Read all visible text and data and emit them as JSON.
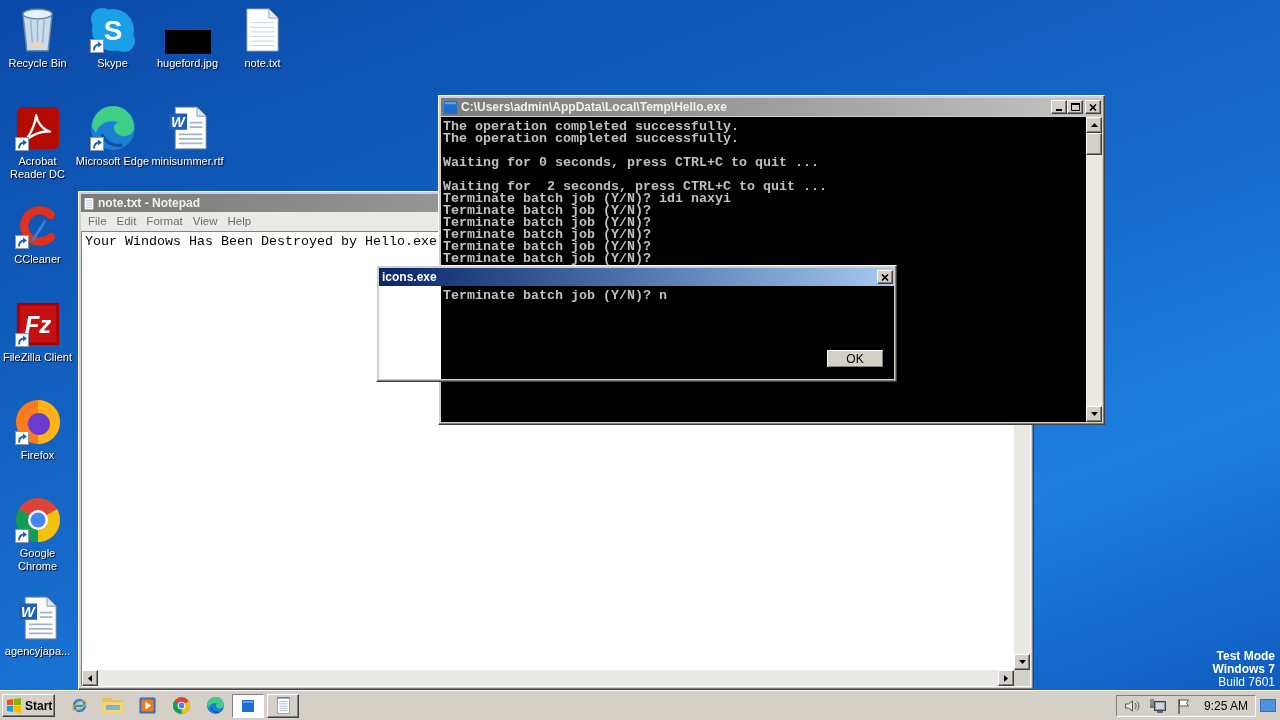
{
  "desktop": {
    "icon_columns": [
      [
        {
          "label": "Recycle Bin",
          "kind": "recycle_bin",
          "shortcut": false
        },
        {
          "label": "Acrobat Reader DC",
          "kind": "acrobat",
          "shortcut": true
        },
        {
          "label": "CCleaner",
          "kind": "ccleaner",
          "shortcut": true
        },
        {
          "label": "FileZilla Client",
          "kind": "filezilla",
          "shortcut": true,
          "glyph": "Fz"
        },
        {
          "label": "Firefox",
          "kind": "firefox",
          "shortcut": true
        },
        {
          "label": "Google Chrome",
          "kind": "chrome",
          "shortcut": true
        },
        {
          "label": "agencyjapa...",
          "kind": "word_document",
          "shortcut": false,
          "glyph": "W"
        }
      ],
      [
        {
          "label": "Skype",
          "kind": "skype",
          "shortcut": true,
          "glyph": "S"
        },
        {
          "label": "Microsoft Edge",
          "kind": "edge",
          "shortcut": true
        }
      ],
      [
        {
          "label": "hugeford.jpg",
          "kind": "image",
          "shortcut": false
        },
        {
          "label": "minisummer.rtf",
          "kind": "word_document",
          "shortcut": false,
          "glyph": "W"
        }
      ],
      [
        {
          "label": "note.txt",
          "kind": "text_document",
          "shortcut": false
        }
      ]
    ],
    "notice": {
      "mode": "Test Mode",
      "edition": "Windows 7",
      "build": "Build 7601"
    }
  },
  "notepad": {
    "title": "note.txt - Notepad",
    "active": false,
    "menu": [
      "File",
      "Edit",
      "Format",
      "View",
      "Help"
    ],
    "text": "Your Windows Has Been Destroyed by Hello.exe"
  },
  "console": {
    "title": "C:\\Users\\admin\\AppData\\Local\\Temp\\Hello.exe",
    "active": false,
    "blocks": [
      [
        "The operation completed successfully.",
        "The operation completed successfully."
      ],
      [
        "Waiting for 0 seconds, press CTRL+C to quit ..."
      ],
      [
        "Waiting for  2 seconds, press CTRL+C to quit ...",
        "Terminate batch job (Y/N)? idi naxyi",
        "Terminate batch job (Y/N)?",
        "Terminate batch job (Y/N)?",
        "Terminate batch job (Y/N)?",
        "Terminate batch job (Y/N)?",
        "Terminate batch job (Y/N)?"
      ]
    ]
  },
  "dialog": {
    "title": "icons.exe",
    "active": true,
    "console_line": "Terminate batch job (Y/N)? n",
    "button": "OK"
  },
  "taskbar": {
    "start": "Start",
    "quick_launch": [
      {
        "kind": "internet_explorer",
        "selected": false
      },
      {
        "kind": "explorer",
        "selected": false
      },
      {
        "kind": "media_player",
        "selected": false
      },
      {
        "kind": "chrome",
        "selected": false
      },
      {
        "kind": "edge",
        "selected": false
      }
    ],
    "tasks": [
      {
        "kind": "console",
        "selected": true
      },
      {
        "kind": "notepad",
        "selected": false
      }
    ],
    "clock": "9:25 AM"
  }
}
